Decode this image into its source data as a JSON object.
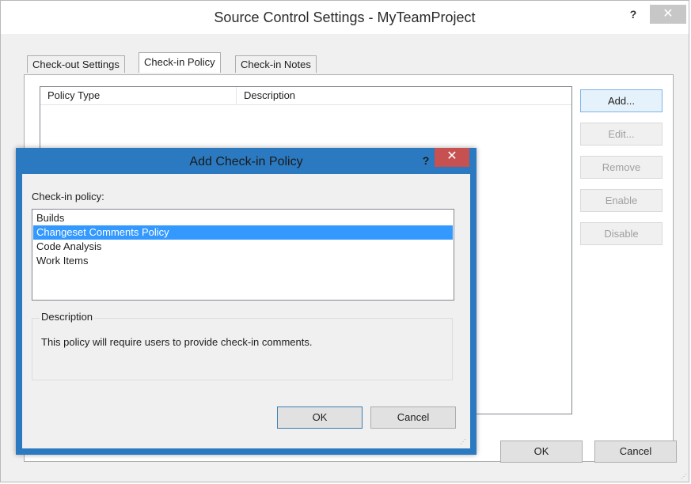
{
  "main_window": {
    "title": "Source Control Settings - MyTeamProject",
    "help_glyph": "?",
    "close_glyph": "✕"
  },
  "tabs": [
    {
      "label": "Check-out Settings"
    },
    {
      "label": "Check-in Policy",
      "active": true
    },
    {
      "label": "Check-in Notes"
    }
  ],
  "policy_list": {
    "columns": [
      "Policy Type",
      "Description"
    ]
  },
  "side_buttons": {
    "add": "Add...",
    "edit": "Edit...",
    "remove": "Remove",
    "enable": "Enable",
    "disable": "Disable"
  },
  "footer": {
    "ok": "OK",
    "cancel": "Cancel"
  },
  "dialog": {
    "title": "Add Check-in Policy",
    "help_glyph": "?",
    "close_glyph": "✕",
    "list_label": "Check-in policy:",
    "items": [
      "Builds",
      "Changeset Comments Policy",
      "Code Analysis",
      "Work Items"
    ],
    "selected_item": "Changeset Comments Policy",
    "description_label": "Description",
    "description_text": "This policy will require users to provide check-in comments.",
    "ok": "OK",
    "cancel": "Cancel"
  },
  "colors": {
    "dialog_frame": "#2b7ac1",
    "selection": "#3399ff",
    "close_active": "#c75050"
  }
}
